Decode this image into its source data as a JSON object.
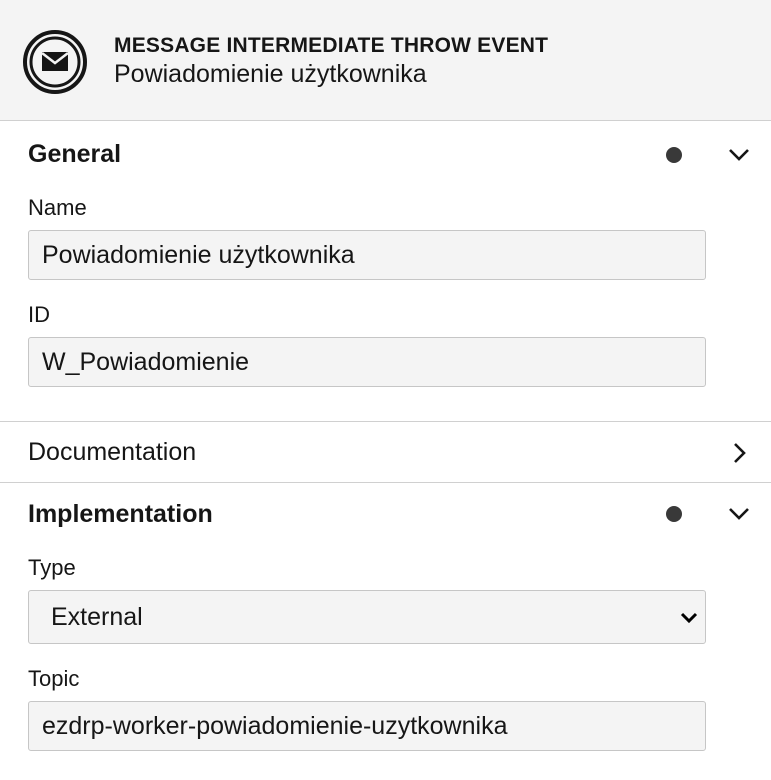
{
  "header": {
    "element_type": "MESSAGE INTERMEDIATE THROW EVENT",
    "element_name": "Powiadomienie użytkownika"
  },
  "groups": {
    "general": {
      "title": "General",
      "name_label": "Name",
      "name_value": "Powiadomienie użytkownika",
      "id_label": "ID",
      "id_value": "W_Powiadomienie"
    },
    "documentation": {
      "title": "Documentation"
    },
    "implementation": {
      "title": "Implementation",
      "type_label": "Type",
      "type_value": "External",
      "topic_label": "Topic",
      "topic_value": "ezdrp-worker-powiadomienie-uzytkownika"
    }
  },
  "icons": {
    "header": "message-throw-event-icon",
    "expanded": "chevron-down-icon",
    "collapsed": "chevron-right-icon",
    "indicator": "dot-indicator-icon"
  },
  "colors": {
    "header_bg": "#f4f4f4",
    "field_bg": "#f4f4f4",
    "border": "#c6c6c6",
    "text": "#161616",
    "dot": "#393939"
  }
}
